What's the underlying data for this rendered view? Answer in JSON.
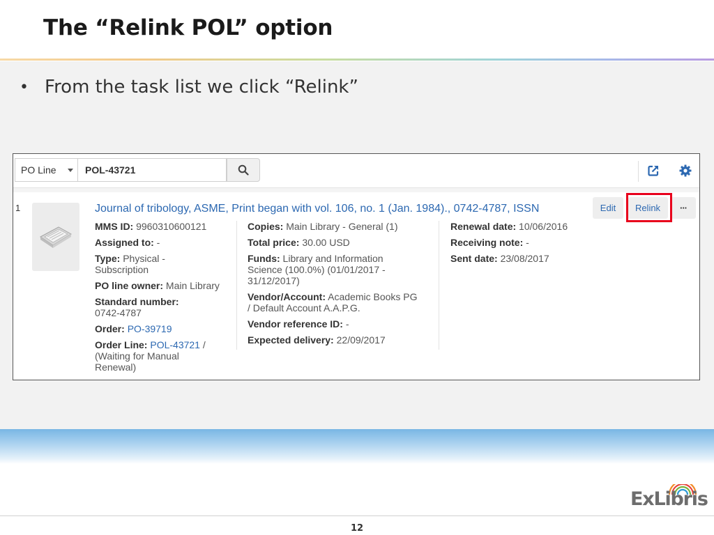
{
  "slide": {
    "title": "The “Relink POL” option",
    "bullet": "From the task list we click “Relink”",
    "page_number": "12",
    "logo_text": "ExLibris"
  },
  "colors": {
    "link": "#2c68b1",
    "highlight": "#e8001c"
  },
  "toolbar": {
    "scope": "PO Line",
    "search_value": "POL-43721",
    "icons": [
      "search-icon",
      "external-link-icon",
      "gear-icon"
    ]
  },
  "record": {
    "index": "1",
    "title": "Journal of tribology, ASME, Print began with vol. 106, no. 1 (Jan. 1984)., 0742-4787, ISSN",
    "col1": {
      "mms_label": "MMS ID:",
      "mms_value": "9960310600121",
      "assigned_label": "Assigned to:",
      "assigned_value": "-",
      "type_label": "Type:",
      "type_value_1": "Physical -",
      "type_value_2": "Subscription",
      "owner_label": "PO line owner:",
      "owner_value": "Main Library",
      "standard_label": "Standard number:",
      "standard_value": "0742-4787",
      "order_label": "Order:",
      "order_value": "PO-39719",
      "orderline_label": "Order Line:",
      "orderline_value": "POL-43721",
      "orderline_sep": " /",
      "orderline_status_1": "(Waiting for Manual",
      "orderline_status_2": "Renewal)"
    },
    "col2": {
      "copies_label": "Copies:",
      "copies_value": "Main Library - General (1)",
      "price_label": "Total price:",
      "price_value": "30.00 USD",
      "funds_label": "Funds:",
      "funds_value_1": "Library and Information",
      "funds_value_2": "Science (100.0%) (01/01/2017 -",
      "funds_value_3": "31/12/2017)",
      "vendor_label": "Vendor/Account:",
      "vendor_value_1": "Academic Books PG",
      "vendor_value_2": "/ Default Account A.A.P.G.",
      "vref_label": "Vendor reference ID:",
      "vref_value": "-",
      "delivery_label": "Expected delivery:",
      "delivery_value": "22/09/2017"
    },
    "col3": {
      "renewal_label": "Renewal date:",
      "renewal_value": "10/06/2016",
      "receiving_label": "Receiving note:",
      "receiving_value": "-",
      "sent_label": "Sent date:",
      "sent_value": "23/08/2017"
    },
    "actions": {
      "edit": "Edit",
      "relink": "Relink",
      "more": "···"
    }
  }
}
